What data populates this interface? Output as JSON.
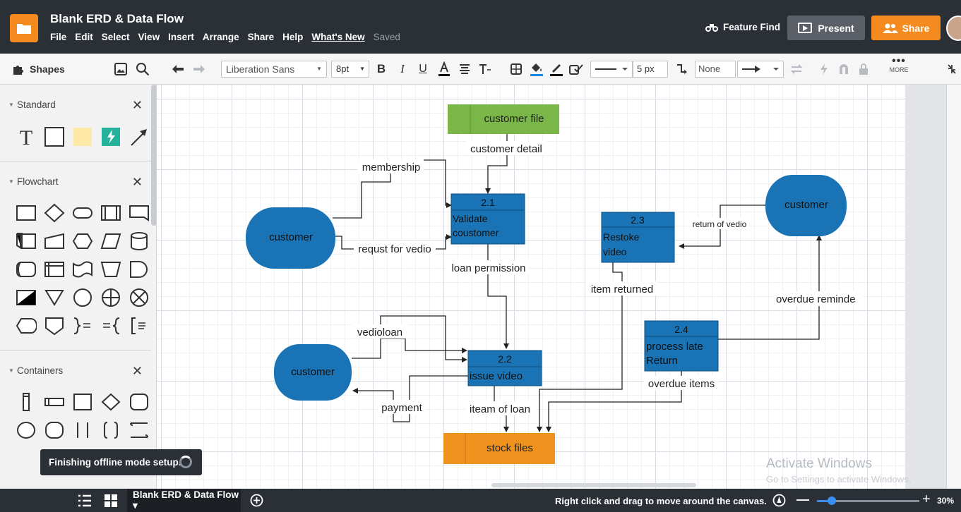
{
  "app": {
    "doc_title": "Blank ERD & Data Flow",
    "menu": [
      "File",
      "Edit",
      "Select",
      "View",
      "Insert",
      "Arrange",
      "Share",
      "Help",
      "What's New",
      "Saved"
    ],
    "feature_find": "Feature Find",
    "present": "Present",
    "share": "Share"
  },
  "toolbar": {
    "shapes_label": "Shapes",
    "font": "Liberation Sans",
    "font_size": "8pt",
    "line_width": "5 px",
    "endpoint": "None",
    "more": "MORE"
  },
  "panel": {
    "sections": [
      "Standard",
      "Flowchart",
      "Containers"
    ]
  },
  "diagram": {
    "nodes": {
      "customer_file": "customer file",
      "validate_id": "2.1",
      "validate_label": "Validate coustomer",
      "restoke_id": "2.3",
      "restoke_label": "Restoke video",
      "issue_id": "2.2",
      "issue_label": "issue video",
      "late_id": "2.4",
      "late_label": "process late Return",
      "stock_files": "stock files",
      "customer1": "customer",
      "customer2": "customer",
      "customer3": "customer"
    },
    "flows": {
      "customer_detail": "customer detail",
      "membership": "membership",
      "request": "requst for vedio",
      "loan_permission": "loan permission",
      "vedioloan": "vedioloan",
      "payment": "payment",
      "iteam_of_loan": "iteam of loan",
      "return_of_vedio": "return of vedio",
      "item_returned": "item returned",
      "overdue_reminder": "overdue reminde",
      "overdue_items": "overdue items"
    },
    "colors": {
      "process": "#1a73b5",
      "store_green": "#7ab648",
      "store_orange": "#f0931e",
      "canvas": "#ffffff"
    }
  },
  "watermark": {
    "line1": "Activate Windows",
    "line2": "Go to Settings to activate Windows."
  },
  "toast": "Finishing offline mode setup.",
  "bottom": {
    "tab": "Blank ERD & Data Flow ▾",
    "hint": "Right click and drag to move around the canvas.",
    "zoom": "30%"
  }
}
